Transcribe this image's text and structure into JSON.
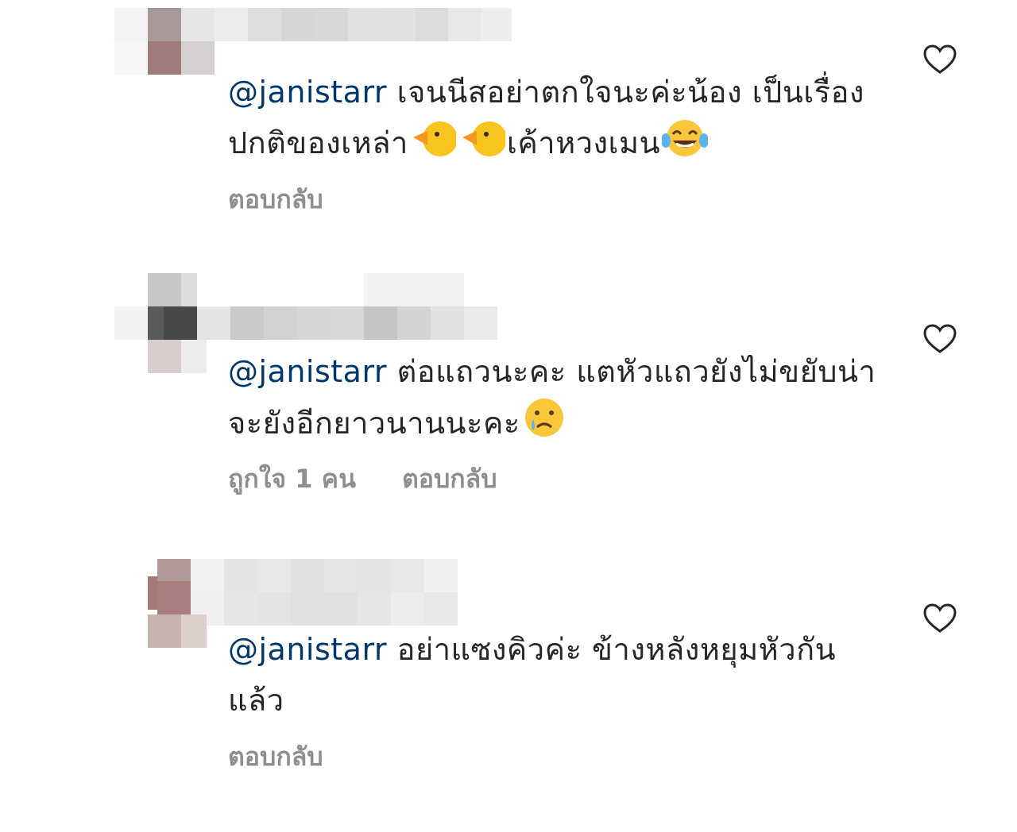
{
  "comments": [
    {
      "mention": "@janistarr",
      "text_before_emoji": " เจนนีสอย่าตกใจนะค่ะน้อง เป็นเรื่องปกติของเหล่า",
      "text_middle": "เค้าหวงเมน",
      "emoji_names": [
        "duck-emoji",
        "duck-emoji",
        "laughing-tears-emoji"
      ],
      "reply_label": "ตอบกลับ"
    },
    {
      "mention": "@janistarr",
      "text": " ต่อแถวนะคะ แตหัวแถวยังไม่ขยับน่าจะยังอีกยาวนานนะคะ",
      "emoji_names": [
        "crying-face-emoji"
      ],
      "likes_label": "ถูกใจ 1 คน",
      "reply_label": "ตอบกลับ"
    },
    {
      "mention": "@janistarr",
      "text": " อย่าแซงคิวค่ะ ข้างหลังหยุมหัวกันแล้ว",
      "reply_label": "ตอบกลับ"
    }
  ],
  "colors": {
    "mention": "#00376b",
    "text": "#262626",
    "secondary": "#8e8e8e"
  },
  "icons": {
    "like": "heart-outline-icon"
  }
}
